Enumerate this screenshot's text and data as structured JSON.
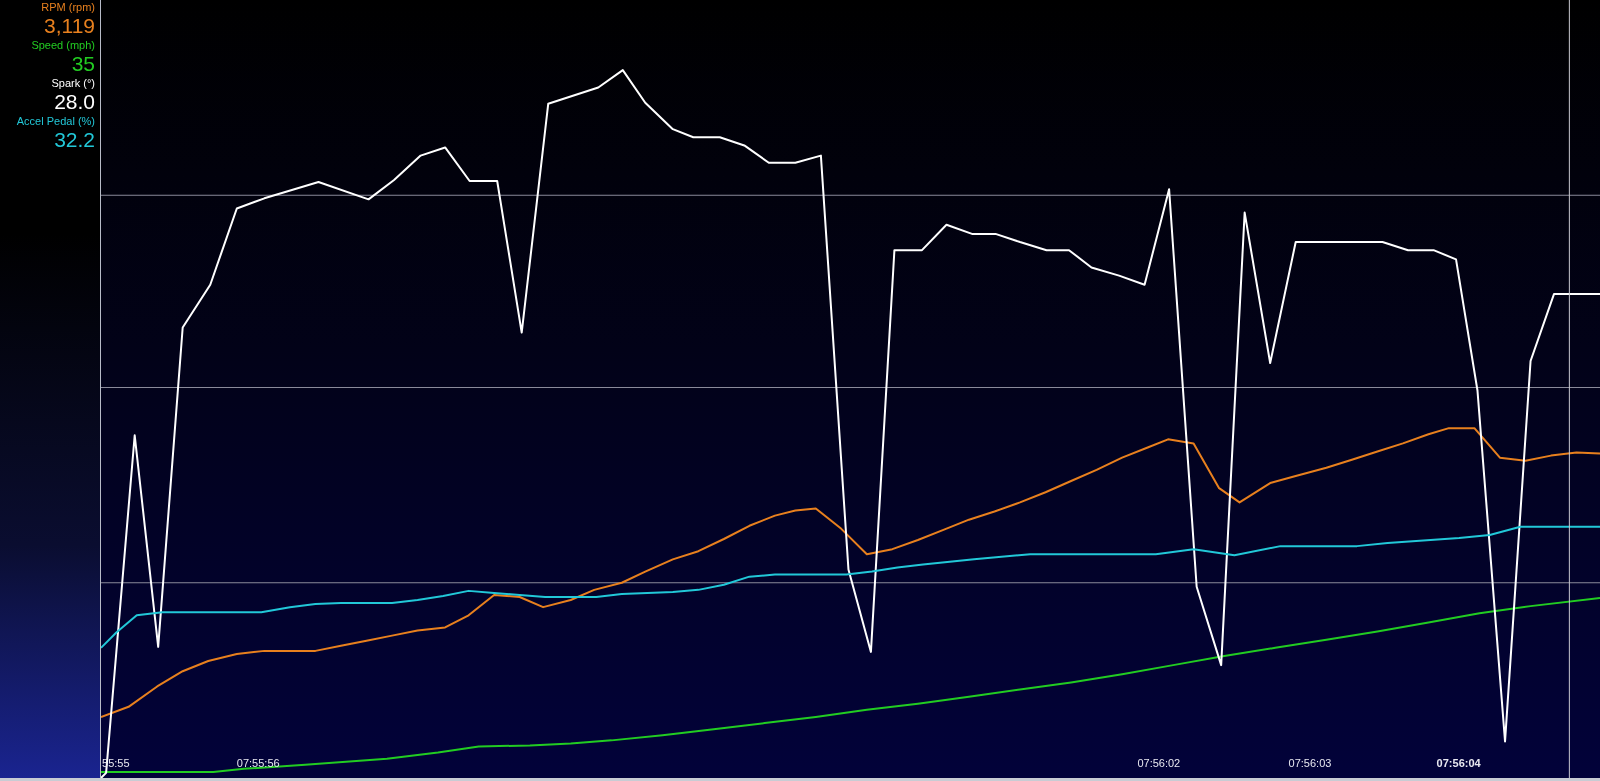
{
  "channels": [
    {
      "name": "RPM (rpm)",
      "value": "3,119",
      "color": "#e8801e"
    },
    {
      "name": "Speed (mph)",
      "value": "35",
      "color": "#22cc22"
    },
    {
      "name": "Spark (°)",
      "value": "28.0",
      "color": "#ffffff"
    },
    {
      "name": "Accel Pedal (%)",
      "value": "32.2",
      "color": "#22c8d8"
    }
  ],
  "time_labels": [
    "55:55",
    "07:55:56",
    "07:56:02",
    "07:56:03",
    "07:56:04"
  ]
}
